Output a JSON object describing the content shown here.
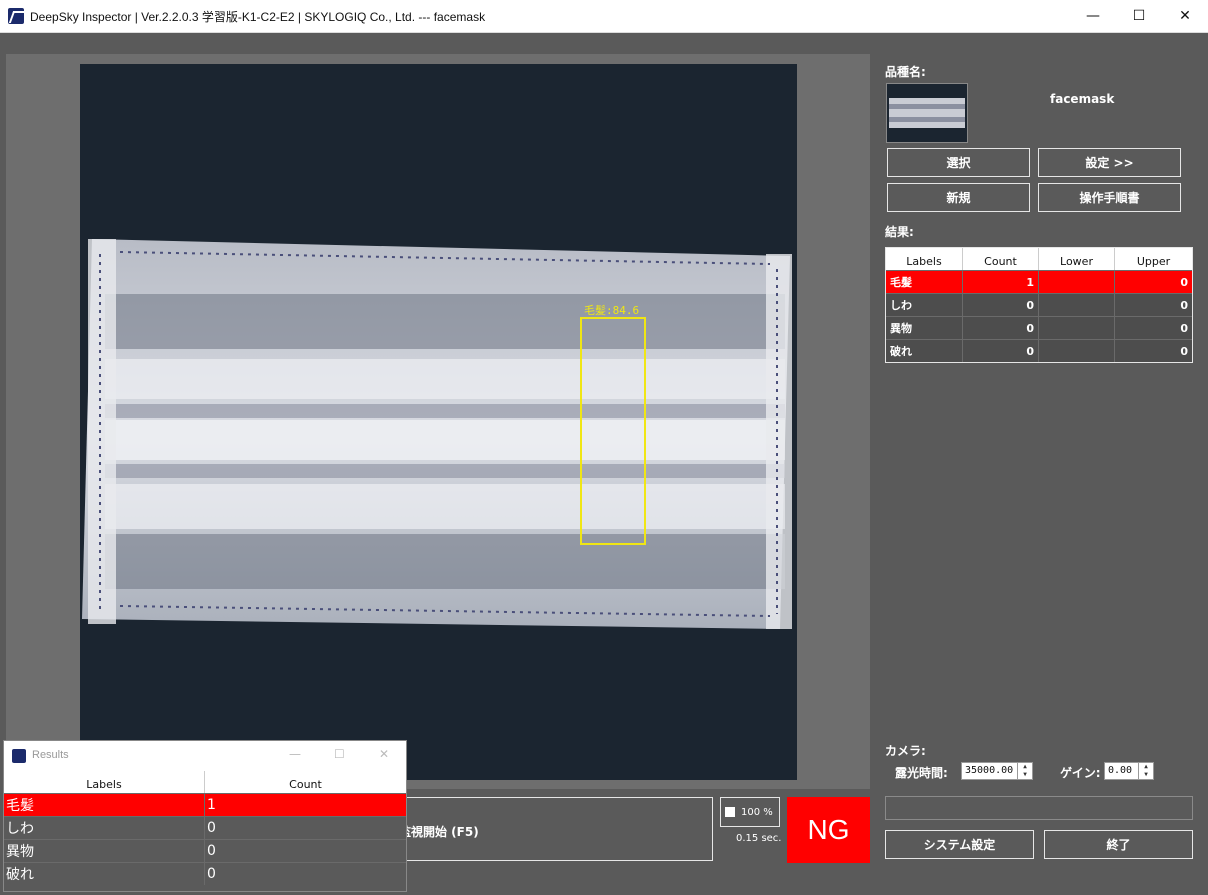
{
  "window": {
    "title": "DeepSky Inspector | Ver.2.2.0.3 学習版-K1-C2-E2 | SKYLOGIQ Co., Ltd. --- facemask",
    "min_icon": "minimize-icon",
    "max_icon": "maximize-icon",
    "close_icon": "close-icon"
  },
  "viewer": {
    "detection_label": "毛髪:84.6",
    "box_color": "#f0e614"
  },
  "product": {
    "section_label": "品種名:",
    "name": "facemask",
    "buttons": {
      "select": "選択",
      "settings": "設定 >>",
      "new": "新規",
      "manual": "操作手順書"
    }
  },
  "results": {
    "section_label": "結果:",
    "columns": [
      "Labels",
      "Count",
      "Lower",
      "Upper"
    ],
    "rows": [
      {
        "label": "毛髪",
        "count": "1",
        "lower": "",
        "upper": "0",
        "ng": true
      },
      {
        "label": "しわ",
        "count": "0",
        "lower": "",
        "upper": "0",
        "ng": false
      },
      {
        "label": "異物",
        "count": "0",
        "lower": "",
        "upper": "0",
        "ng": false
      },
      {
        "label": "破れ",
        "count": "0",
        "lower": "",
        "upper": "0",
        "ng": false
      }
    ]
  },
  "camera": {
    "section_label": "カメラ:",
    "exposure_label": "露光時間:",
    "exposure_value": "35000.00",
    "gain_label": "ゲイン:",
    "gain_value": "0.00"
  },
  "controls": {
    "monitor_start": "監視開始 (F5)",
    "zoom": "100 %",
    "time": "0.15 sec.",
    "judgement": "NG",
    "system_settings": "システム設定",
    "exit": "終了"
  },
  "results_window": {
    "title": "Results",
    "columns": [
      "Labels",
      "Count"
    ],
    "rows": [
      {
        "label": "毛髪",
        "count": "1",
        "ng": true
      },
      {
        "label": "しわ",
        "count": "0",
        "ng": false
      },
      {
        "label": "異物",
        "count": "0",
        "ng": false
      },
      {
        "label": "破れ",
        "count": "0",
        "ng": false
      }
    ]
  },
  "colors": {
    "background": "#5a5a5a",
    "ng": "#ff0000",
    "detection_box": "#f0e614"
  }
}
